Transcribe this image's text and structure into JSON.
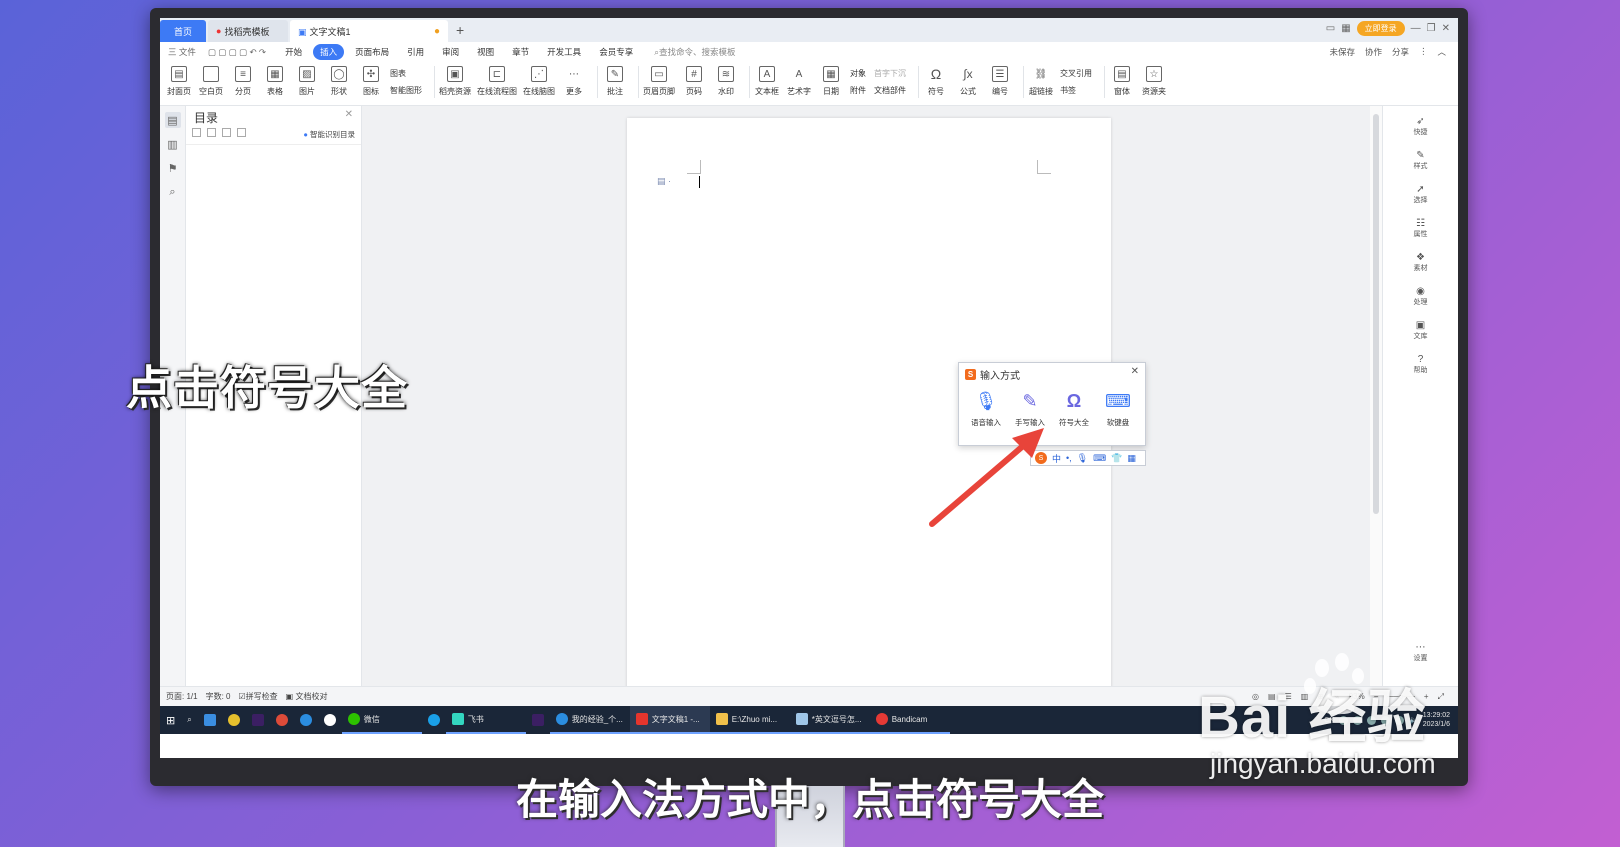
{
  "overlay": {
    "left_caption": "点击符号大全",
    "subtitle": "在输入法方式中，点击符号大全"
  },
  "watermark": {
    "brand": "Bai 经验",
    "url": "jingyan.baidu.com"
  },
  "tabs": {
    "home": "首页",
    "template": "找稻壳模板",
    "document": "文字文稿1"
  },
  "titlebar": {
    "login": "立即登录"
  },
  "menu": {
    "file": "三 文件",
    "items": [
      "开始",
      "插入",
      "页面布局",
      "引用",
      "审阅",
      "视图",
      "章节",
      "开发工具",
      "会员专享"
    ],
    "active": "插入",
    "search": "查找命令、搜索模板",
    "right": [
      "未保存",
      "协作",
      "分享"
    ]
  },
  "ribbon": {
    "buttons": [
      "封面页",
      "空白页",
      "分页",
      "表格",
      "图片",
      "形状",
      "图标"
    ],
    "small1": [
      "图表",
      "智能图形"
    ],
    "buttons2": [
      "稻壳资源",
      "在线流程图",
      "在线脑图",
      "更多",
      "批注",
      "页眉页脚",
      "页码",
      "水印",
      "文本框",
      "艺术字",
      "日期"
    ],
    "small2": [
      "对象",
      "附件"
    ],
    "small3": [
      "首字下沉",
      "文档部件"
    ],
    "buttons3": [
      "符号",
      "公式",
      "编号",
      "超链接"
    ],
    "small4": [
      "交叉引用",
      "书签"
    ],
    "buttons4": [
      "窗体",
      "资源夹"
    ]
  },
  "toc": {
    "title": "目录",
    "smart": "智能识别目录"
  },
  "right_panel": [
    "快捷",
    "样式",
    "选择",
    "属性",
    "素材",
    "处理",
    "文库",
    "帮助"
  ],
  "right_panel_bottom": "设置",
  "status": {
    "page": "页面: 1/1",
    "words": "字数: 0",
    "spell": "拼写检查",
    "proof": "文档校对",
    "zoom": "93%"
  },
  "taskbar": [
    "微信",
    "飞书",
    "我的经验_个...",
    "文字文稿1 -...",
    "E:\\Zhuo mi...",
    "*英文逗号怎...",
    "Bandicam"
  ],
  "tray": {
    "time": "13:29:02",
    "date": "2023/1/6",
    "lang": "CX"
  },
  "ime": {
    "title": "输入方式",
    "options": [
      {
        "label": "语音输入",
        "icon": "microphone-icon",
        "color": "#3d7af5"
      },
      {
        "label": "手写输入",
        "icon": "pen-icon",
        "color": "#6a67e0"
      },
      {
        "label": "符号大全",
        "icon": "omega-icon",
        "color": "#6a67e0"
      },
      {
        "label": "软键盘",
        "icon": "keyboard-icon",
        "color": "#3d7af5"
      }
    ],
    "bar_lang": "中"
  },
  "colors": {
    "accent": "#3d7af5",
    "arrow": "#e8443a"
  }
}
